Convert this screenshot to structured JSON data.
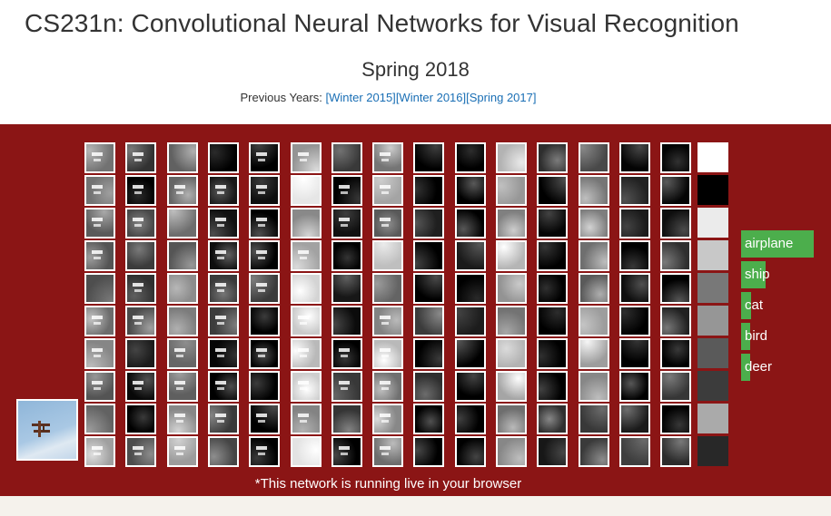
{
  "header": {
    "title": "CS231n: Convolutional Neural Networks for Visual Recognition",
    "term": "Spring 2018",
    "previous_label": "Previous Years:",
    "previous_links": [
      "[Winter 2015]",
      "[Winter 2016]",
      "[Spring 2017]"
    ]
  },
  "network": {
    "caption": "*This network is running live in your browser",
    "predictions": [
      {
        "label": "airplane",
        "score": 1.0
      },
      {
        "label": "ship",
        "score": 0.34
      },
      {
        "label": "cat",
        "score": 0.14
      },
      {
        "label": "bird",
        "score": 0.12
      },
      {
        "label": "deer",
        "score": 0.12
      }
    ],
    "layer_count": 15,
    "filters_per_layer": 10,
    "colors": {
      "band": "#8b1515",
      "prediction": "#4cae4c",
      "link": "#1a6fb5"
    }
  }
}
